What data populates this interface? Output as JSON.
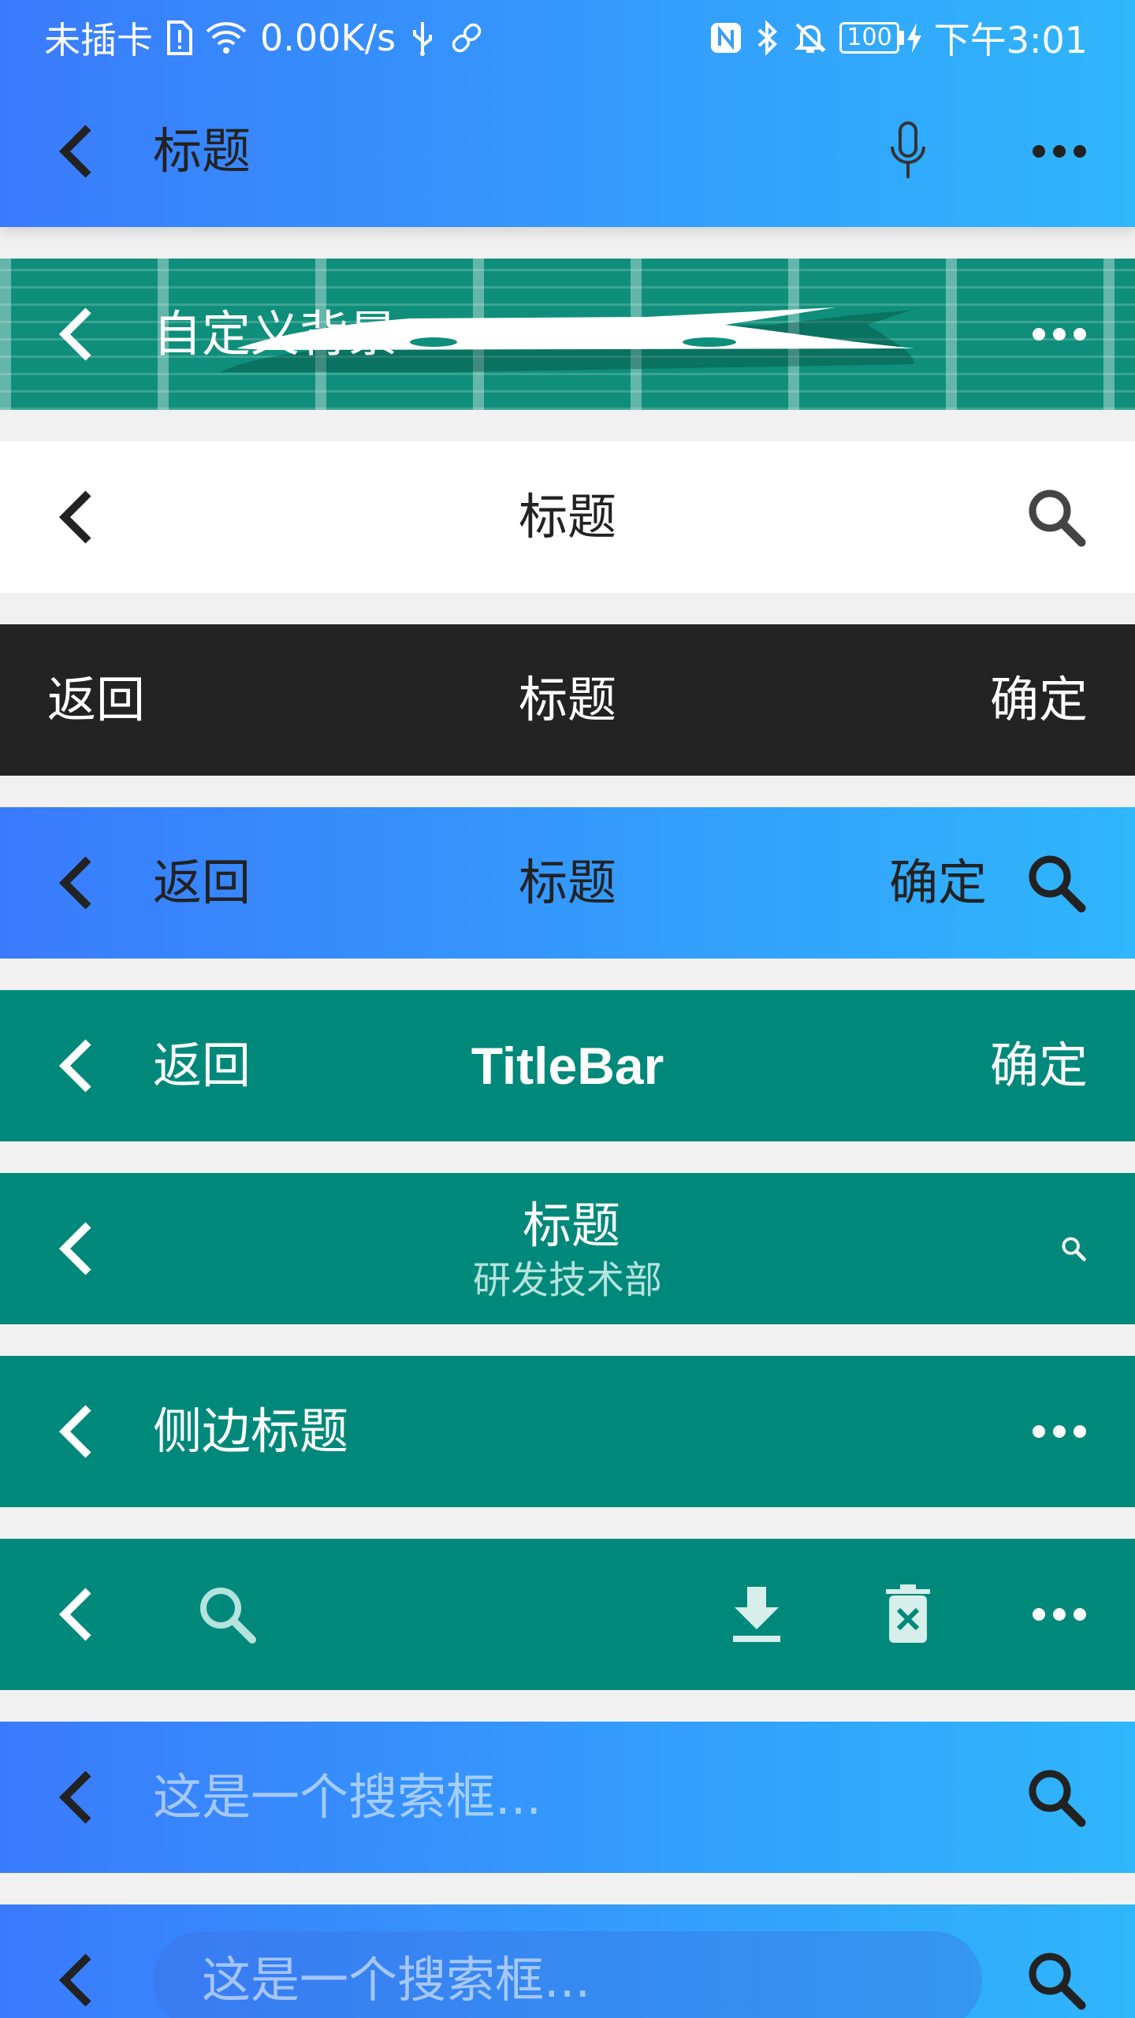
{
  "status_bar": {
    "sim": "未插卡",
    "speed": "0.00K/s",
    "battery": "100",
    "time": "下午3:01"
  },
  "bars": {
    "b1": {
      "title": "标题",
      "icons": [
        "back-icon",
        "microphone-icon",
        "more-icon"
      ]
    },
    "b2": {
      "title": "自定义背景",
      "icons": [
        "back-icon",
        "more-icon"
      ]
    },
    "b3": {
      "title": "标题",
      "icons": [
        "back-icon",
        "search-icon"
      ]
    },
    "b4": {
      "left": "返回",
      "title": "标题",
      "right": "确定"
    },
    "b5": {
      "left": "返回",
      "title": "标题",
      "right": "确定",
      "icons": [
        "back-icon",
        "search-icon"
      ]
    },
    "b6": {
      "left": "返回",
      "title": "TitleBar",
      "right": "确定"
    },
    "b7": {
      "title": "标题",
      "subtitle": "研发技术部"
    },
    "b8": {
      "title": "侧边标题"
    },
    "b9": {
      "icons": [
        "back-icon",
        "search-icon",
        "download-icon",
        "delete-icon",
        "more-icon"
      ]
    },
    "b10": {
      "placeholder": "这是一个搜索框..."
    },
    "b11": {
      "placeholder": "这是一个搜索框..."
    }
  },
  "colors": {
    "gradient_start": "#3a7bfd",
    "gradient_end": "#2fb6fb",
    "teal": "#00897b",
    "dark": "#232323",
    "page_bg": "#f1f1f1"
  }
}
